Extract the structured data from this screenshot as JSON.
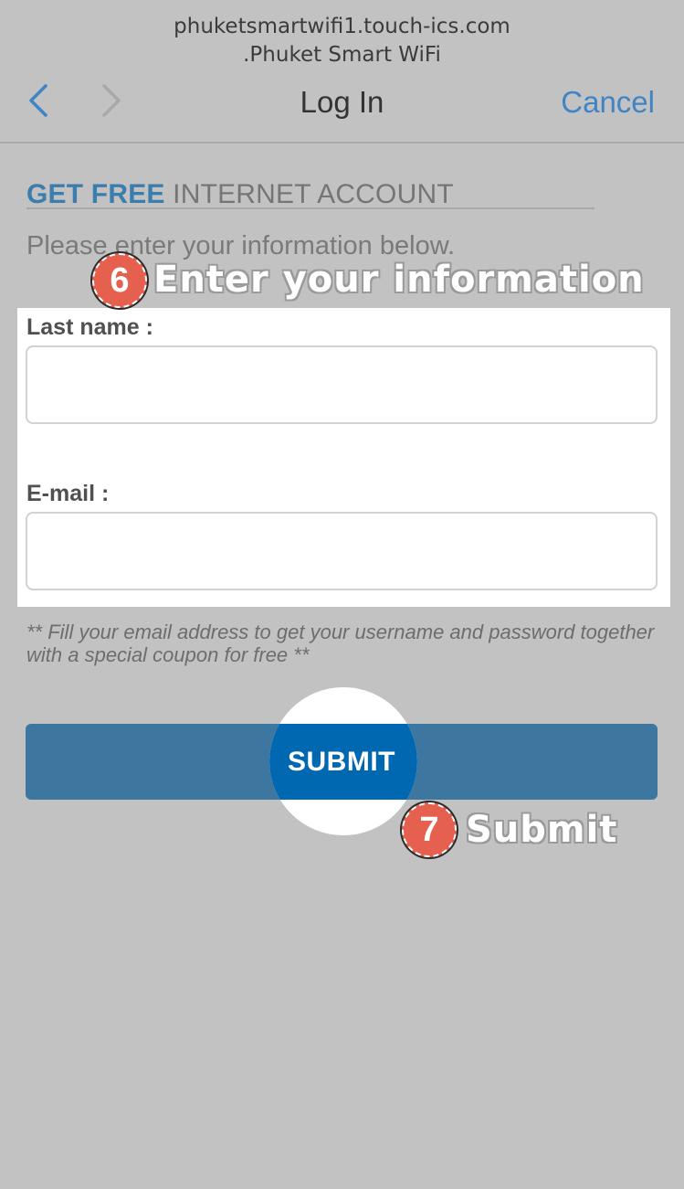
{
  "header": {
    "url": "phuketsmartwifi1.touch-ics.com",
    "network_name": ".Phuket Smart WiFi",
    "title": "Log In",
    "cancel_label": "Cancel"
  },
  "page": {
    "heading_bold": "GET FREE",
    "heading_light": "INTERNET ACCOUNT",
    "intro": "Please enter your information below."
  },
  "form": {
    "last_name_label": "Last name :",
    "last_name_value": "",
    "email_label": "E-mail :",
    "email_value": "",
    "note": "** Fill your email address to get your username and password together with a special coupon for free **",
    "submit_label": "SUBMIT"
  },
  "annotations": {
    "step6_number": "6",
    "step6_text": "Enter your information",
    "step7_number": "7",
    "step7_text": "Submit"
  },
  "colors": {
    "accent": "#3f85c6",
    "submit": "#3d769e",
    "badge": "#e5604e"
  }
}
